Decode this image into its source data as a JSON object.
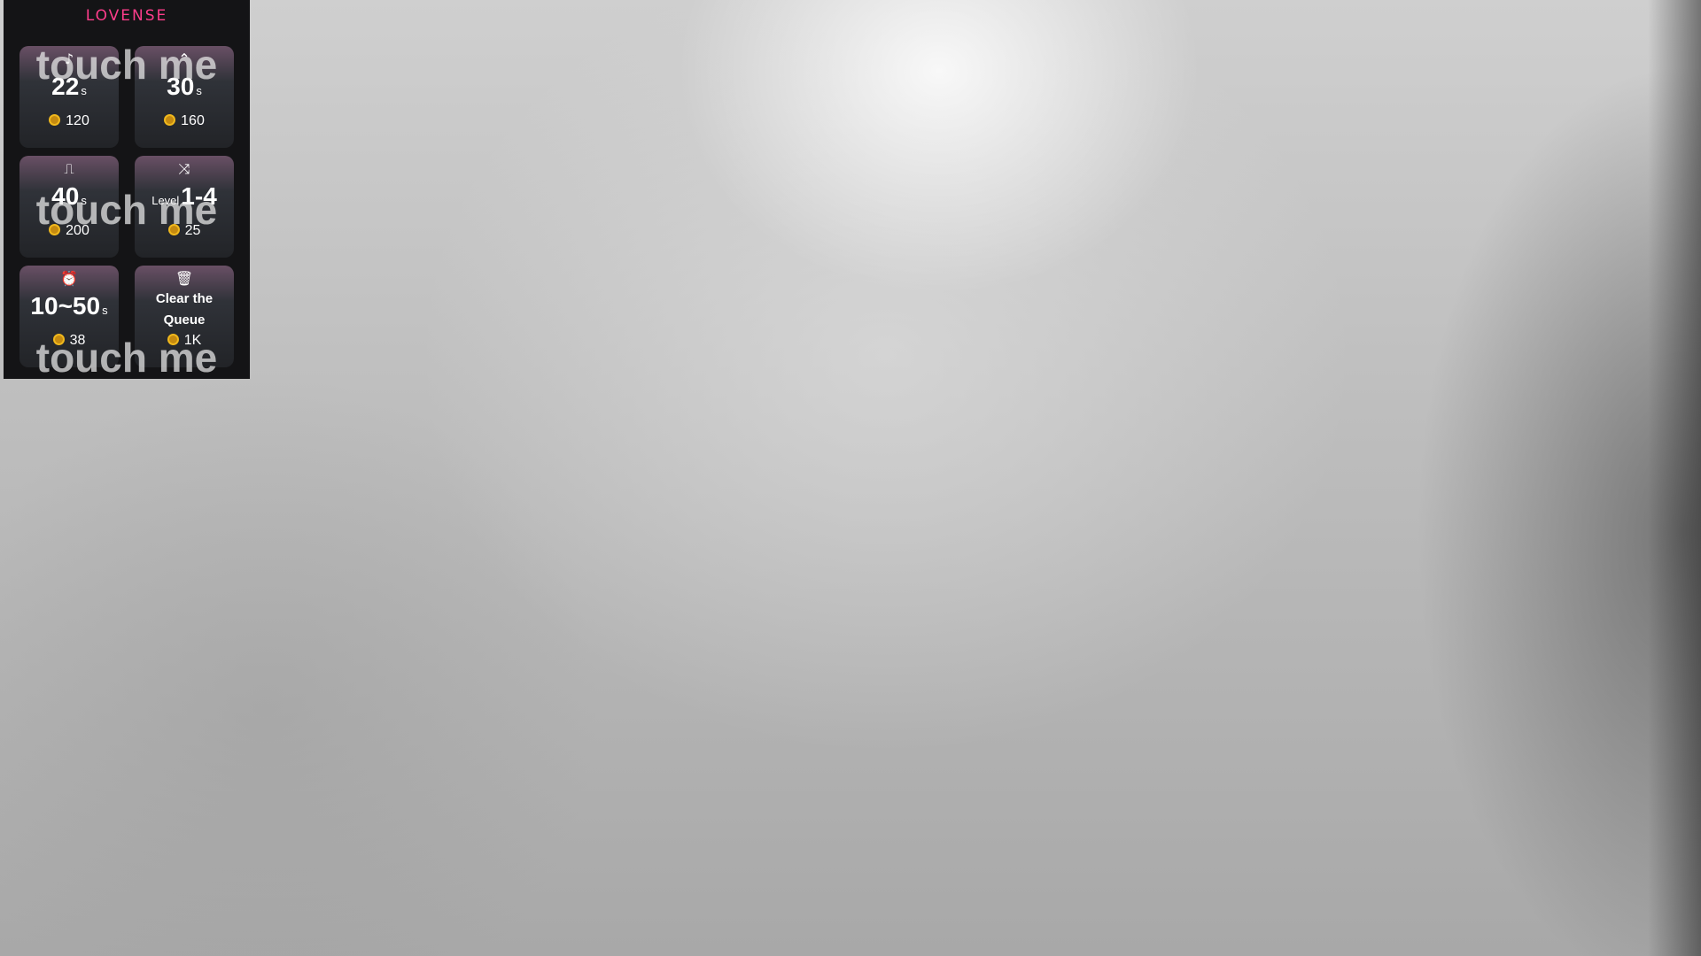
{
  "overlay": {
    "brand": "LOVENSE",
    "brand_color": "#ff3d8b",
    "watermark_text": "touch me",
    "tiles": [
      {
        "icon": "music-note-icon",
        "icon_glyph": "♪",
        "value": "22",
        "unit": "s",
        "price": "120"
      },
      {
        "icon": "wave-icon",
        "icon_glyph": "⌃",
        "value": "30",
        "unit": "s",
        "price": "160"
      },
      {
        "icon": "pulse-icon",
        "icon_glyph": "⎍",
        "value": "40",
        "unit": "s",
        "price": "200"
      },
      {
        "icon": "random-icon",
        "icon_glyph": "⤨",
        "prefix": "Level",
        "value": "1-4",
        "price": "25"
      },
      {
        "icon": "alarm-clock-icon",
        "icon_glyph": "⏰",
        "value": "10~50",
        "unit": "s",
        "price": "38"
      },
      {
        "icon": "trash-icon",
        "icon_glyph": "🗑",
        "label_line1": "Clear the",
        "label_line2": "Queue",
        "price": "1K"
      }
    ]
  }
}
